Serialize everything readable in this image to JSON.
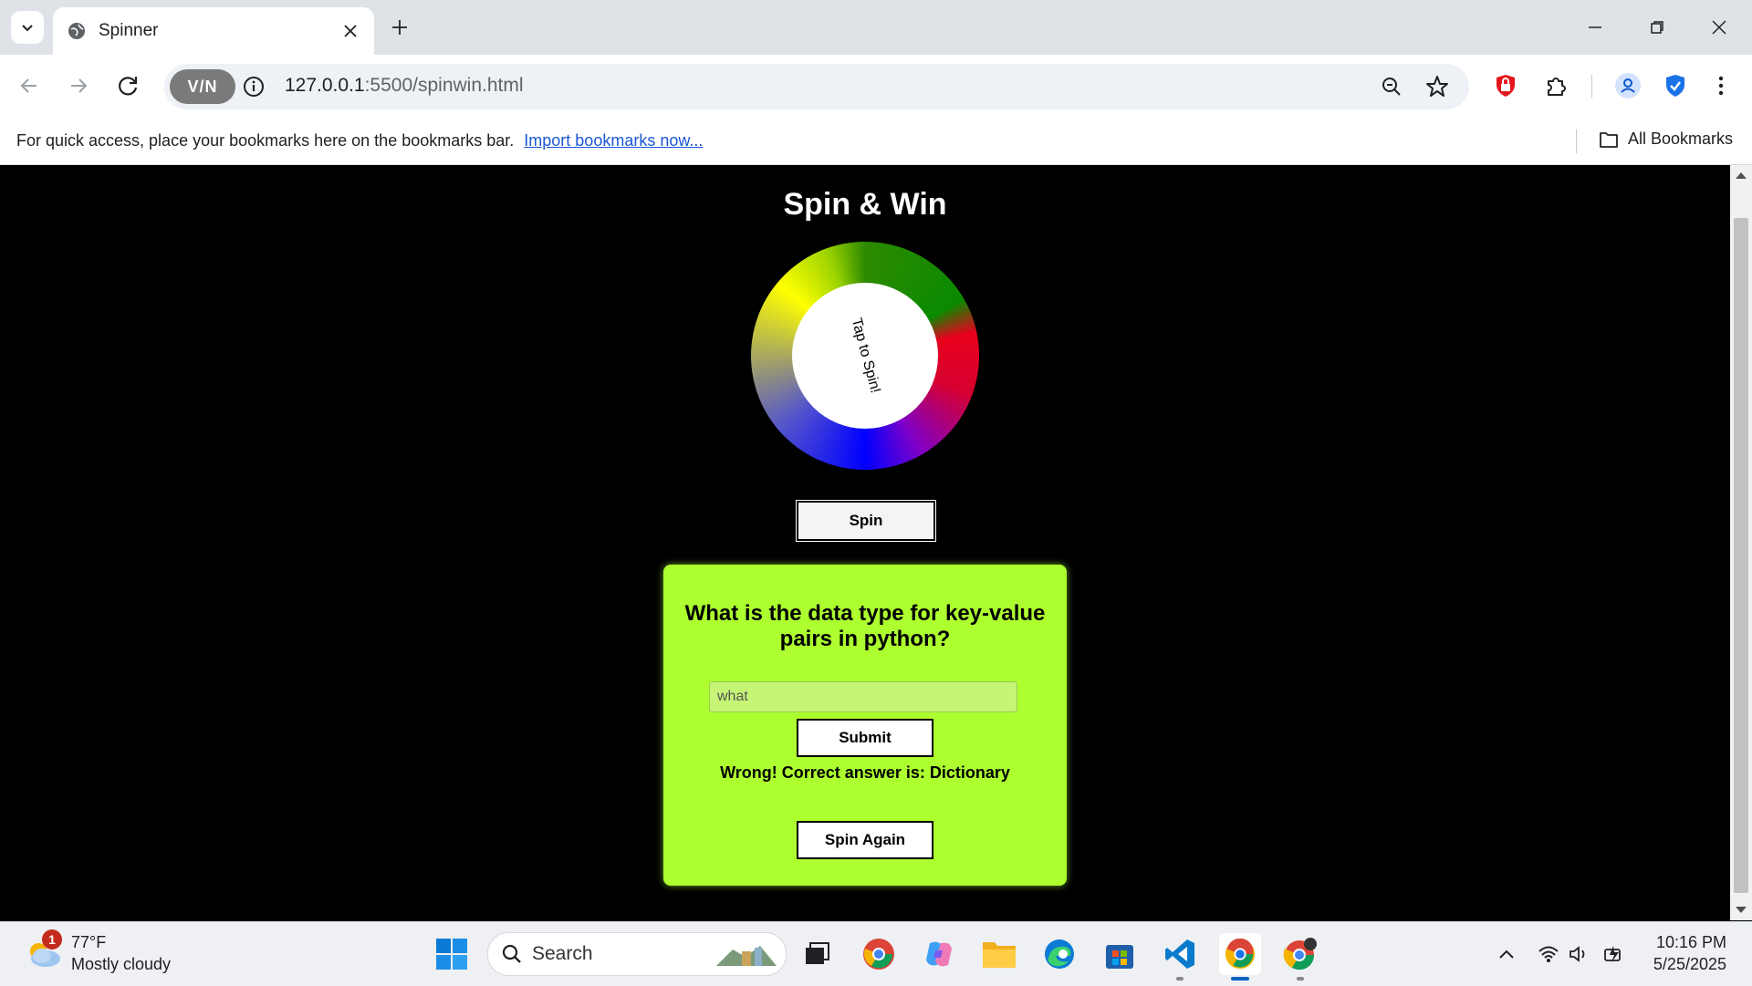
{
  "browser": {
    "tab_title": "Spinner",
    "url_host": "127.0.0.1",
    "url_path": ":5500/spinwin.html",
    "vpn_label": "V/N",
    "bookmarks_prompt": "For quick access, place your bookmarks here on the bookmarks bar.",
    "import_link": "Import bookmarks now...",
    "all_bookmarks": "All Bookmarks"
  },
  "page": {
    "title": "Spin & Win",
    "wheel_label": "Tap to Spin!",
    "spin_button": "Spin",
    "question": "What is the data type for key-value pairs in python?",
    "answer_value": "what",
    "submit_button": "Submit",
    "result_text": "Wrong! Correct answer is: Dictionary",
    "spin_again_button": "Spin Again"
  },
  "taskbar": {
    "weather_temp": "77°F",
    "weather_desc": "Mostly cloudy",
    "weather_badge": "1",
    "search_label": "Search",
    "time": "10:16 PM",
    "date": "5/25/2025"
  },
  "colors": {
    "card_bg": "#adff2f",
    "page_bg": "#000000"
  }
}
